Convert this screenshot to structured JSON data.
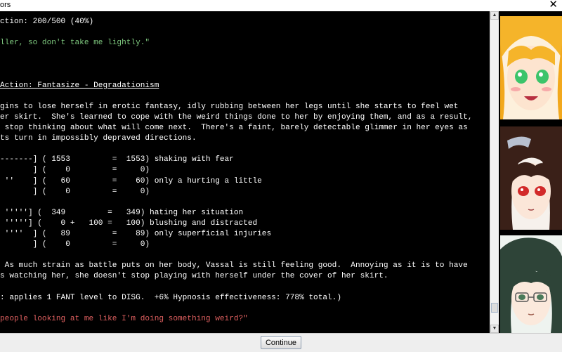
{
  "window": {
    "title": "ors",
    "close_glyph": "✕"
  },
  "console": {
    "lines": [
      {
        "text": "",
        "color": "#ffffff",
        "underline": false
      },
      {
        "text": "ction: 200/500 (40%)",
        "color": "#ffffff",
        "underline": false
      },
      {
        "text": "",
        "color": "#ffffff",
        "underline": false
      },
      {
        "text": "ller, so don't take me lightly.\"",
        "color": "#7fc97f",
        "underline": false
      },
      {
        "text": "",
        "color": "#ffffff",
        "underline": false
      },
      {
        "text": "",
        "color": "#ffffff",
        "underline": false
      },
      {
        "text": "",
        "color": "#ffffff",
        "underline": false
      },
      {
        "text": "Action: Fantasize - Degradationism",
        "color": "#ffffff",
        "underline": true
      },
      {
        "text": "",
        "color": "#ffffff",
        "underline": false
      },
      {
        "text": "gins to lose herself in erotic fantasy, idly rubbing between her legs until she starts to feel wet",
        "color": "#ffffff",
        "underline": false
      },
      {
        "text": "er skirt.  She's learned to cope with the weird things done to her by enjoying them, and as a result,",
        "color": "#ffffff",
        "underline": false
      },
      {
        "text": " stop thinking about what will come next.  There's a faint, barely detectable glimmer in her eyes as",
        "color": "#ffffff",
        "underline": false
      },
      {
        "text": "ts turn in impossibly depraved directions.",
        "color": "#ffffff",
        "underline": false
      },
      {
        "text": "",
        "color": "#ffffff",
        "underline": false
      },
      {
        "text": "-------] ( 1553         =  1553) shaking with fear",
        "color": "#ffffff",
        "underline": false
      },
      {
        "text": "       ] (    0         =     0)",
        "color": "#ffffff",
        "underline": false
      },
      {
        "text": " ''    ] (   60         =    60) only a hurting a little",
        "color": "#ffffff",
        "underline": false
      },
      {
        "text": "       ] (    0         =     0)",
        "color": "#ffffff",
        "underline": false
      },
      {
        "text": "",
        "color": "#ffffff",
        "underline": false
      },
      {
        "text": " '''''] (  349         =   349) hating her situation",
        "color": "#ffffff",
        "underline": false
      },
      {
        "text": " '''''] (    0 +   100 =   100) blushing and distracted",
        "color": "#ffffff",
        "underline": false
      },
      {
        "text": " ''''  ] (   89         =    89) only superficial injuries",
        "color": "#ffffff",
        "underline": false
      },
      {
        "text": "       ] (    0         =     0)",
        "color": "#ffffff",
        "underline": false
      },
      {
        "text": "",
        "color": "#ffffff",
        "underline": false
      },
      {
        "text": " As much strain as battle puts on her body, Vassal is still feeling good.  Annoying as it is to have",
        "color": "#ffffff",
        "underline": false
      },
      {
        "text": "s watching her, she doesn't stop playing with herself under the cover of her skirt.",
        "color": "#ffffff",
        "underline": false
      },
      {
        "text": "",
        "color": "#ffffff",
        "underline": false
      },
      {
        "text": ": applies 1 FANT level to DISG.  +6% Hypnosis effectiveness: 778% total.)",
        "color": "#ffffff",
        "underline": false
      },
      {
        "text": "",
        "color": "#ffffff",
        "underline": false
      },
      {
        "text": "people looking at me like I'm doing something weird?\"",
        "color": "#e06060",
        "underline": false
      }
    ]
  },
  "portraits": [
    {
      "name": "blonde-girl",
      "hair": "#f5b42a",
      "eyes": "#3cc46a"
    },
    {
      "name": "dark-haired-girl",
      "hair": "#3a2018",
      "eyes": "#d22a2a"
    },
    {
      "name": "green-haired-girl",
      "hair": "#2e4438",
      "eyes": "#4a7a5a"
    }
  ],
  "buttons": {
    "continue_label": "Continue"
  },
  "scrollbar": {
    "up_icon": "▲",
    "down_icon": "▼",
    "position": 0.96
  }
}
